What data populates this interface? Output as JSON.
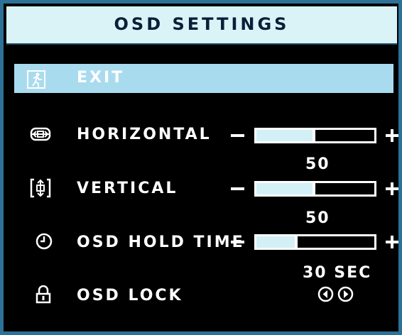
{
  "osd": {
    "title": "OSD SETTINGS",
    "exit_label": "EXIT",
    "items": [
      {
        "label": "HORIZONTAL",
        "value": "50",
        "level": 0.5
      },
      {
        "label": "VERTICAL",
        "value": "50",
        "level": 0.5
      },
      {
        "label": "OSD HOLD TIME",
        "value": "30 SEC",
        "level": 0.35
      },
      {
        "label": "OSD LOCK"
      }
    ]
  },
  "icons": {
    "exit": "running-man-exit-icon",
    "horizontal": "horizontal-position-icon",
    "vertical": "vertical-position-icon",
    "hold_time": "clock-icon",
    "lock": "padlock-icon",
    "left": "left-arrow-circle-icon",
    "right": "right-arrow-circle-icon"
  },
  "colors": {
    "background": "#000000",
    "frame": "#2d7196",
    "header_bg": "#d9f3f6",
    "highlight": "#a9dbef",
    "text": "#ffffff",
    "slider_fill": "#d2f0f6"
  }
}
